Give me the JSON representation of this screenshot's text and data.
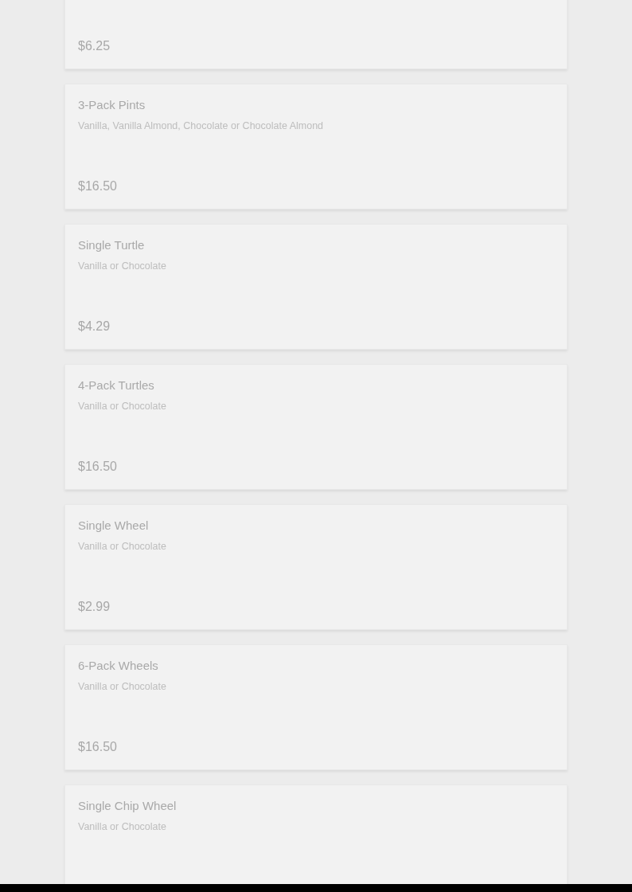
{
  "menu_items": [
    {
      "price": "$6.25"
    },
    {
      "name": "3-Pack Pints",
      "description": "Vanilla, Vanilla Almond, Chocolate or Chocolate Almond",
      "price": "$16.50"
    },
    {
      "name": "Single Turtle",
      "description": "Vanilla or Chocolate",
      "price": "$4.29"
    },
    {
      "name": "4-Pack Turtles",
      "description": "Vanilla or Chocolate",
      "price": "$16.50"
    },
    {
      "name": "Single Wheel",
      "description": "Vanilla or Chocolate",
      "price": "$2.99"
    },
    {
      "name": "6-Pack Wheels",
      "description": "Vanilla or Chocolate",
      "price": "$16.50"
    },
    {
      "name": "Single Chip Wheel",
      "description": "Vanilla or Chocolate"
    }
  ]
}
